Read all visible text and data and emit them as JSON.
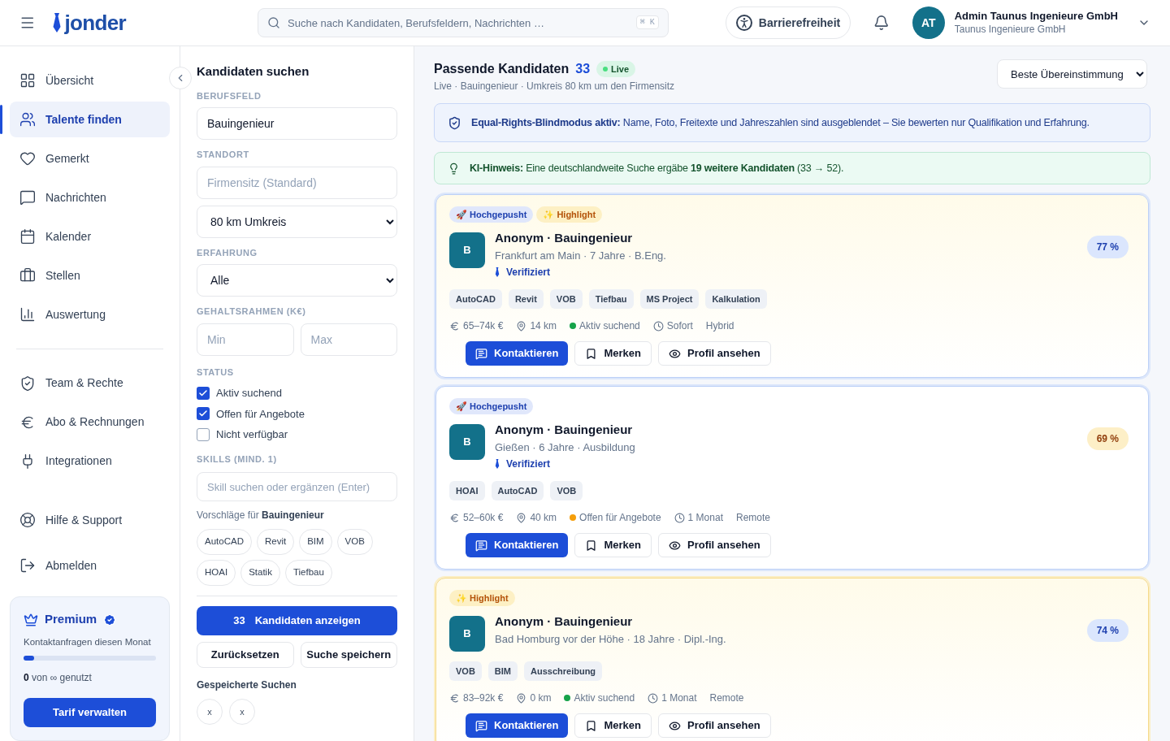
{
  "header": {
    "logo": "jonder",
    "search": {
      "placeholder": "Suche nach Kandidaten, Berufsfeldern, Nachrichten …",
      "shortcut": "⌘ K"
    },
    "accessibility": "Barrierefreiheit",
    "user": {
      "initials": "AT",
      "name": "Admin Taunus Ingenieure GmbH",
      "company": "Taunus Ingenieure GmbH"
    }
  },
  "sidebar": {
    "items": [
      {
        "label": "Übersicht",
        "selected": false
      },
      {
        "label": "Talente finden",
        "selected": true
      },
      {
        "label": "Gemerkt",
        "selected": false
      },
      {
        "label": "Nachrichten",
        "selected": false
      },
      {
        "label": "Kalender",
        "selected": false
      },
      {
        "label": "Stellen",
        "selected": false
      },
      {
        "label": "Auswertung",
        "selected": false
      }
    ],
    "admin_items": [
      {
        "label": "Team & Rechte",
        "selected": false
      },
      {
        "label": "Abo & Rechnungen",
        "selected": false
      },
      {
        "label": "Integrationen",
        "selected": false
      }
    ],
    "bottom_items": [
      {
        "label": "Hilfe & Support"
      },
      {
        "label": "Abmelden"
      }
    ],
    "plan": {
      "title": "Premium",
      "subtitle": "Kontaktanfragen diesen Monat",
      "level": 0.08,
      "usage": "**0** von ∞ genutzt",
      "button": "Tarif verwalten"
    }
  },
  "filters": {
    "title": "Kandidaten suchen",
    "fields": [
      {
        "kind": "input",
        "label": "BERUFSFELD",
        "value": "Bauingenieur"
      },
      {
        "kind": "input",
        "label": "STANDORT",
        "placeholder": "Firmensitz (Standard)"
      },
      {
        "kind": "select",
        "value": "80 km Umkreis"
      },
      {
        "kind": "select",
        "label": "ERFAHRUNG",
        "value": "Alle"
      },
      {
        "kind": "range",
        "label": "GEHALTSRAHMEN (K€)",
        "min_placeholder": "Min",
        "max_placeholder": "Max"
      }
    ],
    "status": {
      "label": "STATUS",
      "options": [
        {
          "label": "Aktiv suchend",
          "checked": true
        },
        {
          "label": "Offen für Angebote",
          "checked": true
        },
        {
          "label": "Nicht verfügbar",
          "checked": false
        }
      ]
    },
    "skills": {
      "label": "SKILLS (MIND. 1)",
      "placeholder": "Skill suchen oder ergänzen (Enter)",
      "hint": "Vorschläge für **Bauingenieur**",
      "suggestions": [
        "AutoCAD",
        "Revit",
        "BIM",
        "VOB",
        "HOAI",
        "Statik",
        "Tiefbau"
      ]
    },
    "submit": {
      "count": "33",
      "label": "Kandidaten anzeigen"
    },
    "reset": "Zurücksetzen",
    "save": "Suche speichern",
    "saved": {
      "title": "Gespeicherte Suchen",
      "items": [
        "x",
        "x"
      ]
    }
  },
  "results": {
    "title": "Passende Kandidaten",
    "count": "33",
    "live": "Live",
    "subtitle": "Live · Bauingenieur · Umkreis 80 km um den Firmensitz",
    "sort": "Beste Übereinstimmung",
    "notices": [
      {
        "kind": "info",
        "text": "**Equal-Rights-Blindmodus aktiv:** Name, Foto, Freitexte und Jahreszahlen sind ausgeblendet – Sie bewerten nur Qualifikation und Erfahrung."
      },
      {
        "kind": "tip",
        "text": "**KI-Hinweis:** Eine deutschlandweite Suche ergäbe **19 weitere Kandidaten** (33 → 52)."
      }
    ],
    "candidates": [
      {
        "boosted": true,
        "highlighted": true,
        "badges": [
          {
            "kind": "boost",
            "label": "🚀 Hochgepusht"
          },
          {
            "kind": "highlight",
            "label": "✨ Highlight"
          }
        ],
        "initial": "B",
        "title": "Anonym · Bauingenieur",
        "details": "Frankfurt am Main · 7 Jahre · B.Eng.",
        "verified": "Verifiziert",
        "score": {
          "kind": "high",
          "label": "77 %"
        },
        "skills": [
          "AutoCAD",
          "Revit",
          "VOB",
          "Tiefbau",
          "MS Project",
          "Kalkulation"
        ],
        "salary": "65–74k €",
        "distance": "14 km",
        "status": {
          "label": "Aktiv suchend",
          "color": "#16a34a"
        },
        "availability": "Sofort",
        "mode": "Hybrid",
        "actions": [
          "Kontaktieren",
          "Merken",
          "Profil ansehen"
        ]
      },
      {
        "boosted": true,
        "highlighted": false,
        "badges": [
          {
            "kind": "boost",
            "label": "🚀 Hochgepusht"
          }
        ],
        "initial": "B",
        "title": "Anonym · Bauingenieur",
        "details": "Gießen · 6 Jahre · Ausbildung",
        "verified": "Verifiziert",
        "score": {
          "kind": "medium",
          "label": "69 %"
        },
        "skills": [
          "HOAI",
          "AutoCAD",
          "VOB"
        ],
        "salary": "52–60k €",
        "distance": "40 km",
        "status": {
          "label": "Offen für Angebote",
          "color": "#f59e0b"
        },
        "availability": "1 Monat",
        "mode": "Remote",
        "actions": [
          "Kontaktieren",
          "Merken",
          "Profil ansehen"
        ]
      },
      {
        "boosted": false,
        "highlighted": true,
        "badges": [
          {
            "kind": "highlight",
            "label": "✨ Highlight"
          }
        ],
        "initial": "B",
        "title": "Anonym · Bauingenieur",
        "details": "Bad Homburg vor der Höhe · 18 Jahre · Dipl.-Ing.",
        "score": {
          "kind": "high",
          "label": "74 %"
        },
        "skills": [
          "VOB",
          "BIM",
          "Ausschreibung"
        ],
        "salary": "83–92k €",
        "distance": "0 km",
        "status": {
          "label": "Aktiv suchend",
          "color": "#16a34a"
        },
        "availability": "1 Monat",
        "mode": "Remote",
        "actions": [
          "Kontaktieren",
          "Merken",
          "Profil ansehen"
        ]
      }
    ]
  }
}
